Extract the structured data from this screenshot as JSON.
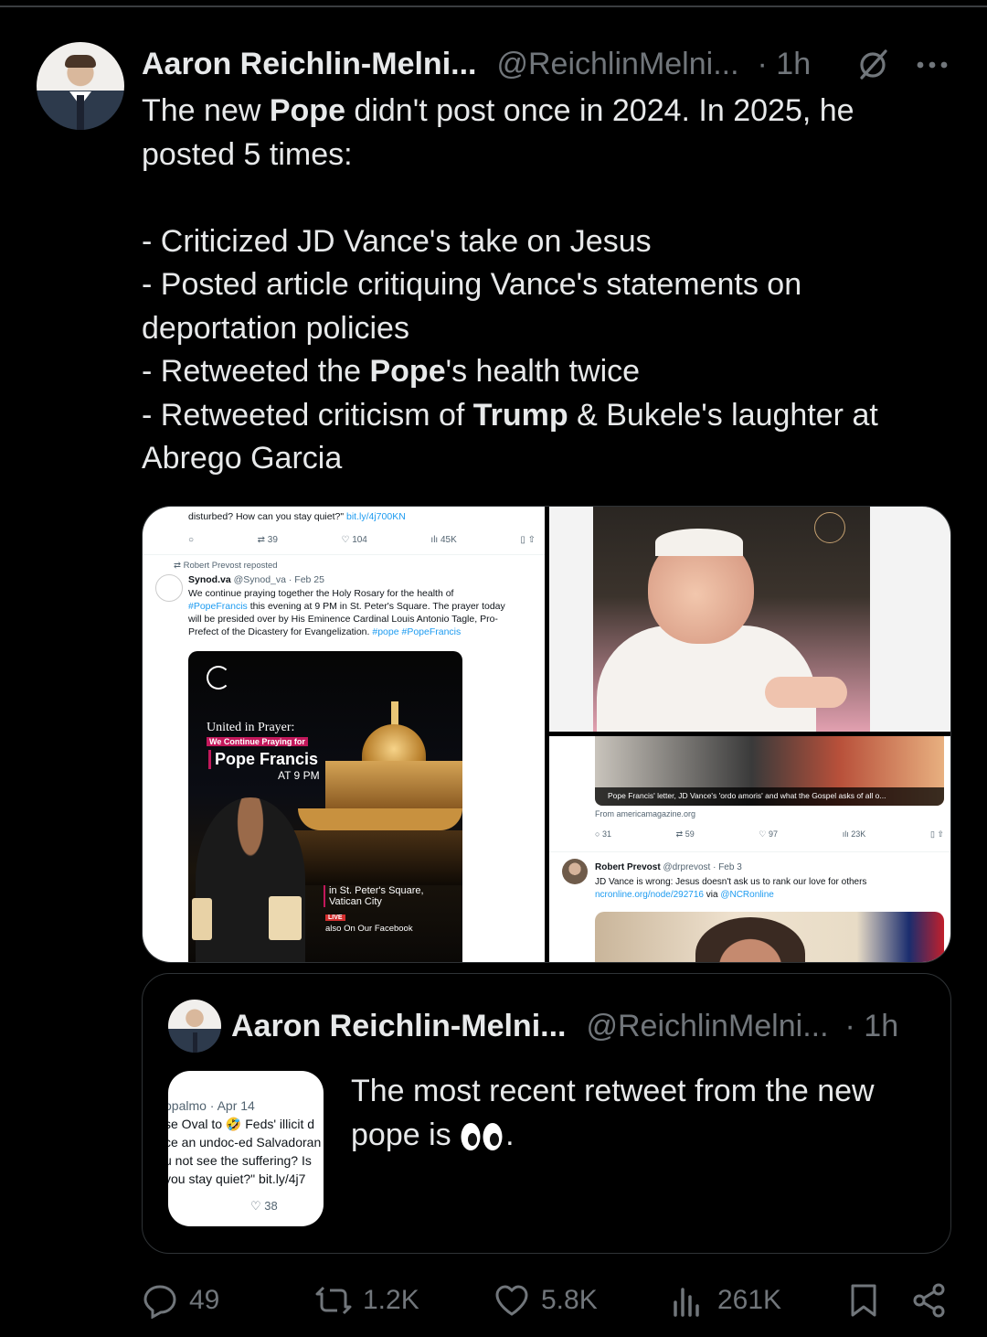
{
  "tweet": {
    "author_name": "Aaron Reichlin-Melni...",
    "handle": "@ReichlinMelni...",
    "time": "· 1h",
    "lines": [
      {
        "pre": "The new ",
        "bold": "Pope",
        "post": " didn't post once in 2024. In 2025, he"
      },
      {
        "pre": "posted 5 times:",
        "bold": "",
        "post": ""
      },
      {
        "pre": "- Criticized JD Vance's take on Jesus",
        "bold": "",
        "post": ""
      },
      {
        "pre": "- Posted article critiquing Vance's statements on",
        "bold": "",
        "post": ""
      },
      {
        "pre": "deportation policies",
        "bold": "",
        "post": ""
      },
      {
        "pre": "- Retweeted the ",
        "bold": "Pope",
        "post": "'s health twice"
      },
      {
        "pre": "- Retweeted criticism of ",
        "bold": "Trump",
        "post": " & Bukele's laughter at"
      },
      {
        "pre": "Abrego Garcia",
        "bold": "",
        "post": ""
      }
    ]
  },
  "media": {
    "left": {
      "top_text": "disturbed? How can you stay quiet?\"",
      "top_link": "bit.ly/4j700KN",
      "top_stats": {
        "retweets": "39",
        "likes": "104",
        "views": "45K"
      },
      "repost_label": "Robert Prevost reposted",
      "author": "Synod.va",
      "author_meta": "@Synod_va · Feb 25",
      "body_1": "We continue praying together the Holy Rosary for the health of",
      "body_2_link": "#PopeFrancis",
      "body_2": " this evening at 9 PM in St. Peter's Square. The prayer today",
      "body_3": "will be presided over by His Eminence Cardinal Louis Antonio Tagle, Pro-",
      "body_4": "Prefect of the Dicastery for Evangelization. ",
      "body_4_link": "#pope #PopeFrancis",
      "poster": {
        "line1": "United in Prayer:",
        "line2": "We Continue Praying for",
        "line3": "Pope Francis",
        "line4": "AT 9 PM",
        "loc_1": "in St. Peter's Square,",
        "loc_2": "Vatican City",
        "live": "LIVE",
        "facebook": "also On Our Facebook"
      }
    },
    "bottom_right": {
      "banner_caption": "Pope Francis' letter, JD Vance's 'ordo amoris' and what the Gospel asks of all o...",
      "source": "From americamagazine.org",
      "stats": {
        "replies": "31",
        "retweets": "59",
        "likes": "97",
        "views": "23K"
      },
      "author": "Robert Prevost",
      "author_meta": "@drprevost · Feb 3",
      "body": "JD Vance is wrong: Jesus doesn't ask us to rank our love for others",
      "link": "ncronline.org/node/292716",
      "via": " via ",
      "via_handle": "@NCRonline"
    }
  },
  "quote": {
    "author_name": "Aaron Reichlin-Melni...",
    "handle": "@ReichlinMelni...",
    "time": "· 1h",
    "text": "The most recent retweet from the new pope is",
    "text_end": ".",
    "thumb_lines": [
      "opalmo · Apr 14",
      "se Oval to 🤣 Feds' illicit d",
      "ce an undoc-ed Salvadoran",
      "u not see the suffering? Is",
      "you stay quiet?\" bit.ly/4j7"
    ],
    "thumb_likes": "38"
  },
  "actions": {
    "replies": "49",
    "retweets": "1.2K",
    "likes": "5.8K",
    "views": "261K"
  },
  "colors": {
    "background": "#000000",
    "text": "#e7e9ea",
    "muted": "#71767b",
    "link": "#1d9bf0",
    "border": "#2f3336"
  }
}
